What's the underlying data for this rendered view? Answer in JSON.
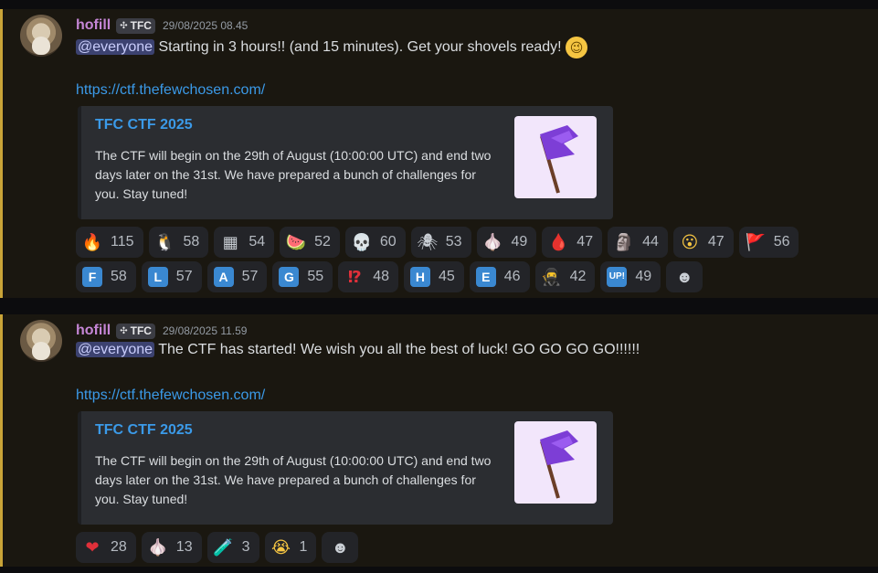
{
  "messages": [
    {
      "username": "hofill",
      "tag": "TFC",
      "timestamp": "29/08/2025 08.45",
      "mention": "@everyone",
      "text": " Starting in 3 hours!! (and 15 minutes). Get your shovels ready!",
      "link": "https://ctf.thefewchosen.com/",
      "embed": {
        "title": "TFC CTF 2025",
        "description": "The CTF will begin on the 29th of August (10:00:00 UTC) and end two days later on the 31st. We have prepared a bunch of challenges for you. Stay tuned!"
      },
      "reactions_row1": [
        {
          "icon": "fire-icon",
          "glyph": "🔥",
          "count": "115"
        },
        {
          "icon": "penguin-icon",
          "glyph": "🐧",
          "count": "58"
        },
        {
          "icon": "custom-image-icon",
          "glyph": "▦",
          "count": "54"
        },
        {
          "icon": "watermelon-icon",
          "glyph": "🍉",
          "count": "52"
        },
        {
          "icon": "skull-icon",
          "glyph": "💀",
          "count": "60"
        },
        {
          "icon": "spider-icon",
          "glyph": "🕷",
          "count": "53"
        },
        {
          "icon": "garlic-icon",
          "glyph": "🧄",
          "count": "49"
        },
        {
          "icon": "drop-of-blood-icon",
          "glyph": "🩸",
          "count": "47"
        },
        {
          "icon": "moai-icon",
          "glyph": "🗿",
          "count": "44"
        },
        {
          "icon": "surprised-face-icon",
          "glyph": "😮",
          "count": "47"
        },
        {
          "icon": "triangular-flag-icon",
          "glyph": "🚩",
          "count": "56"
        }
      ],
      "reactions_row2": [
        {
          "icon": "letter-f-icon",
          "glyph": "F",
          "count": "58"
        },
        {
          "icon": "letter-l-icon",
          "glyph": "L",
          "count": "57"
        },
        {
          "icon": "letter-a-icon",
          "glyph": "A",
          "count": "57"
        },
        {
          "icon": "letter-g-icon",
          "glyph": "G",
          "count": "55"
        },
        {
          "icon": "interrobang-icon",
          "glyph": "⁉",
          "count": "48"
        },
        {
          "icon": "letter-h-icon",
          "glyph": "H",
          "count": "45"
        },
        {
          "icon": "letter-e-icon",
          "glyph": "E",
          "count": "46"
        },
        {
          "icon": "ninja-icon",
          "glyph": "🥷",
          "count": "42"
        },
        {
          "icon": "up-button-icon",
          "glyph": "UP!",
          "count": "49"
        }
      ]
    },
    {
      "username": "hofill",
      "tag": "TFC",
      "timestamp": "29/08/2025 11.59",
      "mention": "@everyone",
      "text": " The CTF has started! We wish you all the best of luck! GO GO GO GO!!!!!!",
      "link": "https://ctf.thefewchosen.com/",
      "embed": {
        "title": "TFC CTF 2025",
        "description": "The CTF will begin on the 29th of August (10:00:00 UTC) and end two days later on the 31st. We have prepared a bunch of challenges for you. Stay tuned!"
      },
      "reactions_row1": [
        {
          "icon": "red-heart-icon",
          "glyph": "❤",
          "count": "28"
        },
        {
          "icon": "garlic-icon",
          "glyph": "🧄",
          "count": "13"
        },
        {
          "icon": "potion-bottle-icon",
          "glyph": "🧪",
          "count": "3"
        },
        {
          "icon": "crying-face-icon",
          "glyph": "😭",
          "count": "1"
        }
      ]
    }
  ],
  "colors": {
    "username": "#c586d6",
    "link": "#3b9ae8",
    "mention_bg": "#3c4270",
    "highlight_border": "#c9a438"
  }
}
